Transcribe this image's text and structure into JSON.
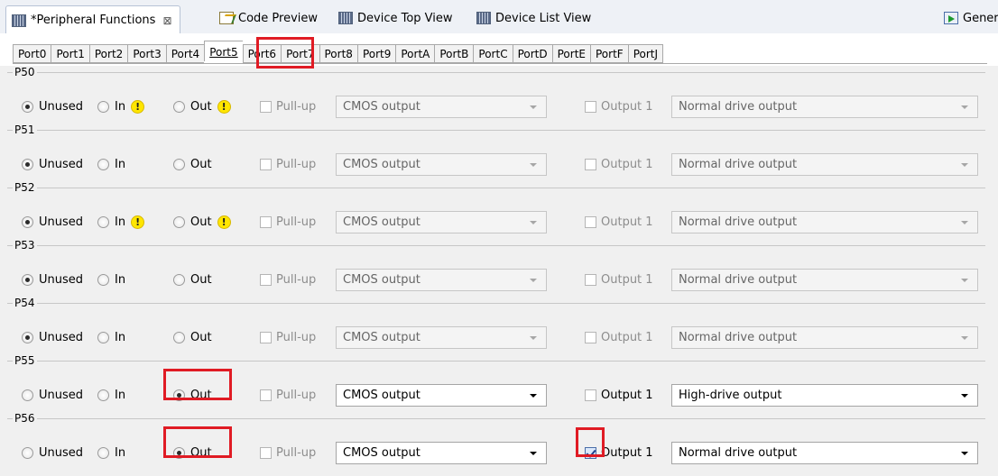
{
  "editor_tabs": [
    {
      "label": "*Peripheral Functions",
      "icon": "chip-icon"
    },
    {
      "label": "Code Preview",
      "icon": "code-icon"
    },
    {
      "label": "Device Top View",
      "icon": "chip-icon"
    },
    {
      "label": "Device List View",
      "icon": "chip-icon"
    },
    {
      "label": "Gener",
      "icon": "generate-icon"
    }
  ],
  "close_glyph": "⊠",
  "port_tabs": [
    "Port0",
    "Port1",
    "Port2",
    "Port3",
    "Port4",
    "Port5",
    "Port6",
    "Port7",
    "Port8",
    "Port9",
    "PortA",
    "PortB",
    "PortC",
    "PortD",
    "PortE",
    "PortF",
    "PortJ"
  ],
  "selected_port": "Port5",
  "labels": {
    "unused": "Unused",
    "in": "In",
    "out": "Out",
    "pullup": "Pull-up",
    "output1": "Output 1",
    "warning_glyph": "!"
  },
  "pins": [
    {
      "name": "P50",
      "mode": "Unused",
      "warnings": true,
      "pullup": false,
      "enabled": false,
      "output_type": "CMOS output",
      "output1": false,
      "drive": "Normal drive output"
    },
    {
      "name": "P51",
      "mode": "Unused",
      "warnings": false,
      "pullup": false,
      "enabled": false,
      "output_type": "CMOS output",
      "output1": false,
      "drive": "Normal drive output"
    },
    {
      "name": "P52",
      "mode": "Unused",
      "warnings": true,
      "pullup": false,
      "enabled": false,
      "output_type": "CMOS output",
      "output1": false,
      "drive": "Normal drive output"
    },
    {
      "name": "P53",
      "mode": "Unused",
      "warnings": false,
      "pullup": false,
      "enabled": false,
      "output_type": "CMOS output",
      "output1": false,
      "drive": "Normal drive output"
    },
    {
      "name": "P54",
      "mode": "Unused",
      "warnings": false,
      "pullup": false,
      "enabled": false,
      "output_type": "CMOS output",
      "output1": false,
      "drive": "Normal drive output"
    },
    {
      "name": "P55",
      "mode": "Out",
      "warnings": false,
      "pullup": false,
      "enabled": true,
      "output_type": "CMOS output",
      "output1": false,
      "drive": "High-drive output"
    },
    {
      "name": "P56",
      "mode": "Out",
      "warnings": false,
      "pullup": false,
      "enabled": true,
      "output_type": "CMOS output",
      "output1": true,
      "drive": "Normal drive output"
    }
  ],
  "colors": {
    "highlight": "#e01b24",
    "warning": "#ffe600"
  }
}
